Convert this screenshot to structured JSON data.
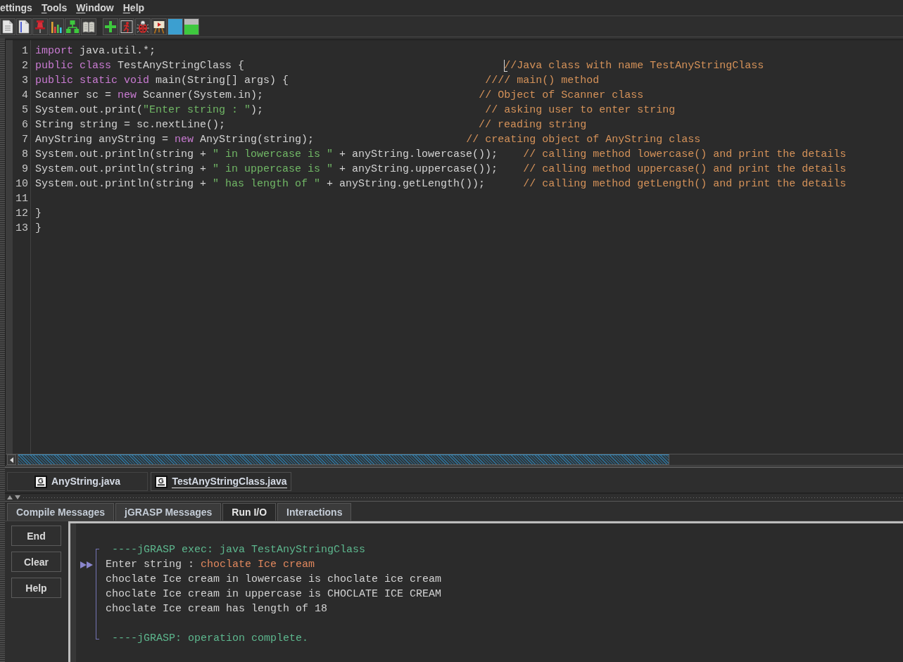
{
  "menu_bar": [
    {
      "label": "ettings",
      "mnemonic": false
    },
    {
      "label": "Tools",
      "mnemonic": true
    },
    {
      "label": "Window",
      "mnemonic": true
    },
    {
      "label": "Help",
      "mnemonic": true
    }
  ],
  "editor": {
    "lines": [
      {
        "number": "1",
        "caret": false,
        "tokens": [
          {
            "kind": "keyword",
            "text": "import"
          },
          {
            "kind": "plain",
            "text": " java.util.*;"
          }
        ]
      },
      {
        "number": "2",
        "caret": true,
        "tokens": [
          {
            "kind": "keyword",
            "text": "public"
          },
          {
            "kind": "keyword",
            "text": " class"
          },
          {
            "kind": "plain",
            "text": " TestAnyStringClass {"
          },
          {
            "kind": "comment",
            "text": "                                         //Java class with name TestAnyStringClass"
          }
        ]
      },
      {
        "number": "3",
        "caret": false,
        "tokens": [
          {
            "kind": "keyword",
            "text": "public"
          },
          {
            "kind": "keyword",
            "text": " static"
          },
          {
            "kind": "keyword",
            "text": " void"
          },
          {
            "kind": "plain",
            "text": " main(String[] args) {"
          },
          {
            "kind": "comment",
            "text": "                               //// main() method"
          }
        ]
      },
      {
        "number": "4",
        "caret": false,
        "tokens": [
          {
            "kind": "plain",
            "text": "Scanner sc = "
          },
          {
            "kind": "keyword",
            "text": "new"
          },
          {
            "kind": "plain",
            "text": " Scanner(System.in);"
          },
          {
            "kind": "comment",
            "text": "                                  // Object of Scanner class"
          }
        ]
      },
      {
        "number": "5",
        "caret": false,
        "tokens": [
          {
            "kind": "plain",
            "text": "System.out.print("
          },
          {
            "kind": "string",
            "text": "\"Enter string : \""
          },
          {
            "kind": "plain",
            "text": ");"
          },
          {
            "kind": "comment",
            "text": "                                   // asking user to enter string"
          }
        ]
      },
      {
        "number": "6",
        "caret": false,
        "tokens": [
          {
            "kind": "plain",
            "text": "String string = sc.nextLine();"
          },
          {
            "kind": "comment",
            "text": "                                        // reading string"
          }
        ]
      },
      {
        "number": "7",
        "caret": false,
        "tokens": [
          {
            "kind": "plain",
            "text": "AnyString anyString = "
          },
          {
            "kind": "keyword",
            "text": "new"
          },
          {
            "kind": "plain",
            "text": " AnyString(string);"
          },
          {
            "kind": "comment",
            "text": "                        // creating object of AnyString class"
          }
        ]
      },
      {
        "number": "8",
        "caret": false,
        "tokens": [
          {
            "kind": "plain",
            "text": "System.out.println(string + "
          },
          {
            "kind": "string",
            "text": "\" in lowercase is \""
          },
          {
            "kind": "plain",
            "text": " + anyString.lowercase());"
          },
          {
            "kind": "comment",
            "text": "    // calling method lowercase() and print the details"
          }
        ]
      },
      {
        "number": "9",
        "caret": false,
        "tokens": [
          {
            "kind": "plain",
            "text": "System.out.println(string + "
          },
          {
            "kind": "string",
            "text": "\" in uppercase is \""
          },
          {
            "kind": "plain",
            "text": " + anyString.uppercase());"
          },
          {
            "kind": "comment",
            "text": "    // calling method uppercase() and print the details"
          }
        ]
      },
      {
        "number": "10",
        "caret": false,
        "tokens": [
          {
            "kind": "plain",
            "text": "System.out.println(string + "
          },
          {
            "kind": "string",
            "text": "\" has length of \""
          },
          {
            "kind": "plain",
            "text": " + anyString.getLength());"
          },
          {
            "kind": "comment",
            "text": "      // calling method getLength() and print the details"
          }
        ]
      },
      {
        "number": "11",
        "caret": false
      },
      {
        "number": "12",
        "caret": false,
        "tokens": [
          {
            "kind": "plain",
            "text": "}"
          }
        ]
      },
      {
        "number": "13",
        "caret": false,
        "tokens": [
          {
            "kind": "plain",
            "text": "}"
          }
        ]
      }
    ]
  },
  "file_tabs": [
    {
      "label": "AnyString.java",
      "selected": false
    },
    {
      "label": "TestAnyStringClass.java",
      "selected": true
    }
  ],
  "message_tabs": [
    {
      "label": "Compile Messages",
      "selected": false
    },
    {
      "label": "jGRASP Messages",
      "selected": false
    },
    {
      "label": "Run I/O",
      "selected": true
    },
    {
      "label": "Interactions",
      "selected": false
    }
  ],
  "run_buttons": [
    "End",
    "Clear",
    "Help"
  ],
  "output": {
    "lines": [
      {
        "kind": "text",
        "input_marker": false,
        "segments": [
          {
            "kind": "system",
            "text": " ----jGRASP exec: java TestAnyStringClass"
          }
        ]
      },
      {
        "kind": "text",
        "input_marker": true,
        "segments": [
          {
            "kind": "plain",
            "text": "Enter string : "
          },
          {
            "kind": "input",
            "text": "choclate Ice cream"
          }
        ]
      },
      {
        "kind": "text",
        "input_marker": false,
        "segments": [
          {
            "kind": "plain",
            "text": "choclate Ice cream in lowercase is choclate ice cream"
          }
        ]
      },
      {
        "kind": "text",
        "input_marker": false,
        "segments": [
          {
            "kind": "plain",
            "text": "choclate Ice cream in uppercase is CHOCLATE ICE CREAM"
          }
        ]
      },
      {
        "kind": "text",
        "input_marker": false,
        "segments": [
          {
            "kind": "plain",
            "text": "choclate Ice cream has length of 18"
          }
        ]
      },
      {
        "kind": "blank",
        "input_marker": false
      },
      {
        "kind": "text",
        "input_marker": false,
        "segments": [
          {
            "kind": "system",
            "text": " ----jGRASP: operation complete."
          }
        ]
      }
    ]
  }
}
